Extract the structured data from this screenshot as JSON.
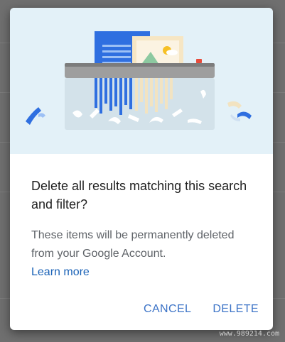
{
  "dialog": {
    "title": "Delete all results matching this search and filter?",
    "body": "These items will be permanently deleted from your Google Account.",
    "learn_more": "Learn more",
    "cancel_label": "CANCEL",
    "delete_label": "DELETE"
  },
  "watermark": "www.989214.com",
  "colors": {
    "illustration_bg": "#e3f1f8",
    "accent": "#3d74c7",
    "overlay": "#6f6f6f"
  }
}
